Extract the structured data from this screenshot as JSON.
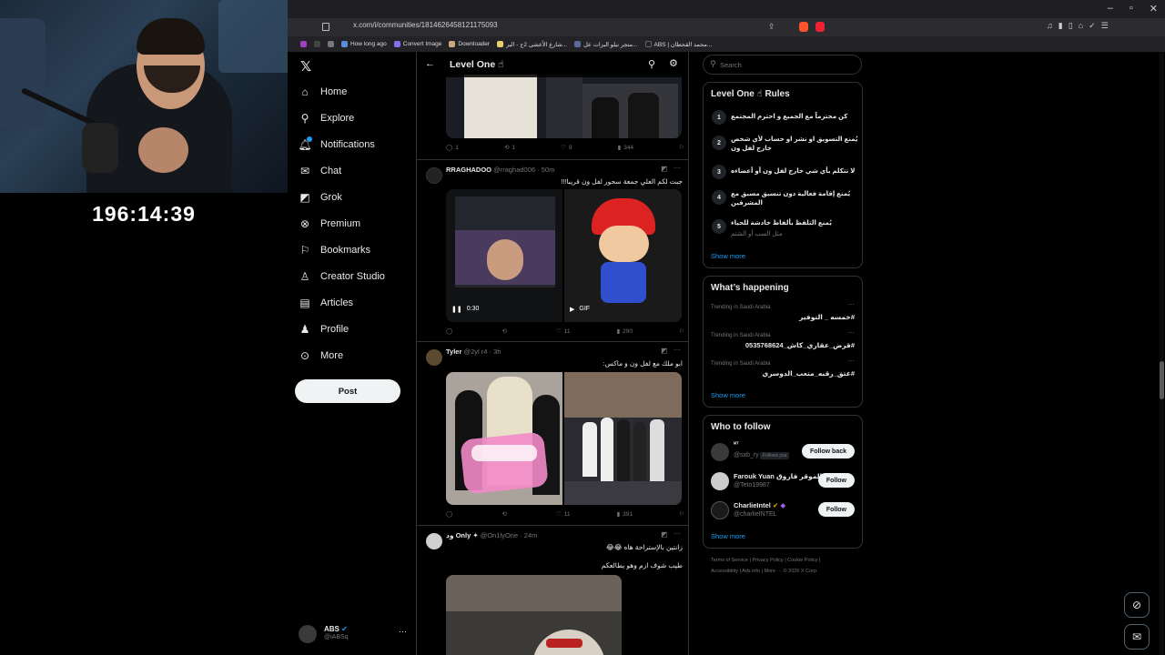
{
  "stream": {
    "timer": "196:14:39"
  },
  "browser": {
    "url": "x.com/i/communities/1814626458121175093",
    "bookmarks": [
      "How long ago",
      "Convert Image",
      "Downloader",
      "شارع الأعشى 2ج - البر...",
      "متجر نيلو البزات عل...",
      "ABS | محمد القحطان..."
    ]
  },
  "nav": {
    "items": [
      {
        "label": "Home",
        "icon": "home-icon"
      },
      {
        "label": "Explore",
        "icon": "search-icon"
      },
      {
        "label": "Notifications",
        "icon": "bell-icon"
      },
      {
        "label": "Chat",
        "icon": "mail-icon"
      },
      {
        "label": "Grok",
        "icon": "grok-icon"
      },
      {
        "label": "Premium",
        "icon": "x-logo-icon"
      },
      {
        "label": "Bookmarks",
        "icon": "bookmark-icon"
      },
      {
        "label": "Creator Studio",
        "icon": "creator-icon"
      },
      {
        "label": "Articles",
        "icon": "article-icon"
      },
      {
        "label": "Profile",
        "icon": "person-icon"
      },
      {
        "label": "More",
        "icon": "more-circle-icon"
      }
    ],
    "post_label": "Post",
    "account": {
      "name": "ABS",
      "handle": "@iABSq"
    }
  },
  "community": {
    "title": "Level One ☝",
    "tweets": [
      {
        "stats": {
          "replies": "1",
          "reposts": "1",
          "likes": "9",
          "views": "344"
        }
      },
      {
        "name": "RRAGHADOO",
        "handle": "@rraghad006 · 50m",
        "text": "جبت لكم العلي جمعة سحور لفل ون قريبا!!!",
        "video_time": "0:30",
        "gif_label": "GIF",
        "stats": {
          "replies": "",
          "reposts": "",
          "likes": "11",
          "views": "290"
        }
      },
      {
        "name": "Tyler",
        "handle": "@2yl r4 · 3h",
        "text": "ابو ملك مع لفل ون و ماكس:",
        "stats": {
          "replies": "",
          "reposts": "",
          "likes": "11",
          "views": "391"
        }
      },
      {
        "name": "ود Only ✦",
        "handle": "@On1lyOne · 24m",
        "text": "زانتين بالإستراحة هاه 😂😂",
        "text2": "طيب شوف ازم وهو يطالعكم"
      }
    ]
  },
  "sidebar": {
    "search_placeholder": "Search",
    "rules": {
      "title": "Level One ☝ Rules",
      "items": [
        {
          "num": "1",
          "text": "كن محترماً مع الجميع و احترم المجتمع"
        },
        {
          "num": "2",
          "text": "يُمنع التسويق او نشر او حساب لأي شخص خارج لفل ون"
        },
        {
          "num": "3",
          "text": "لا تتكلم بأي شي خارج لفل ون أو أعضاءه"
        },
        {
          "num": "4",
          "text": "يُمنع إقامة فعالية دون تنسيق مسبق مع المشرفين"
        },
        {
          "num": "5",
          "text": "يُمنع التلفظ بألفاظ خادشة للحياء",
          "sub": "مثل السب أو الشتم"
        }
      ],
      "show_more": "Show more"
    },
    "trending": {
      "title": "What’s happening",
      "items": [
        {
          "category": "Trending in Saudi Arabia",
          "tag": "#خمسه _ التوفير"
        },
        {
          "category": "Trending in Saudi Arabia",
          "tag": "#قرض_عقاري_كاش_0535768624"
        },
        {
          "category": "Trending in Saudi Arabia",
          "tag": "#عتق_رقبه_متعب_الدوسري"
        }
      ],
      "show_more": "Show more"
    },
    "who_to_follow": {
      "title": "Who to follow",
      "items": [
        {
          "name": "ᴹᵀ",
          "handle": "@sxb_ry",
          "badge": "Follows you",
          "button": "Follow back"
        },
        {
          "name": "Farouk Yuan الموقر فاروق",
          "handle": "@Teto19987",
          "button": "Follow"
        },
        {
          "name": "CharlieIntel",
          "handle": "@charlieINTEL",
          "button": "Follow"
        }
      ],
      "show_more": "Show more"
    },
    "footer": {
      "line1": "Terms of Service  |  Privacy Policy  |  Cookie Policy  |",
      "line2": "Accessibility  |  Ads info  |  More ···  © 2026 X Corp."
    }
  }
}
